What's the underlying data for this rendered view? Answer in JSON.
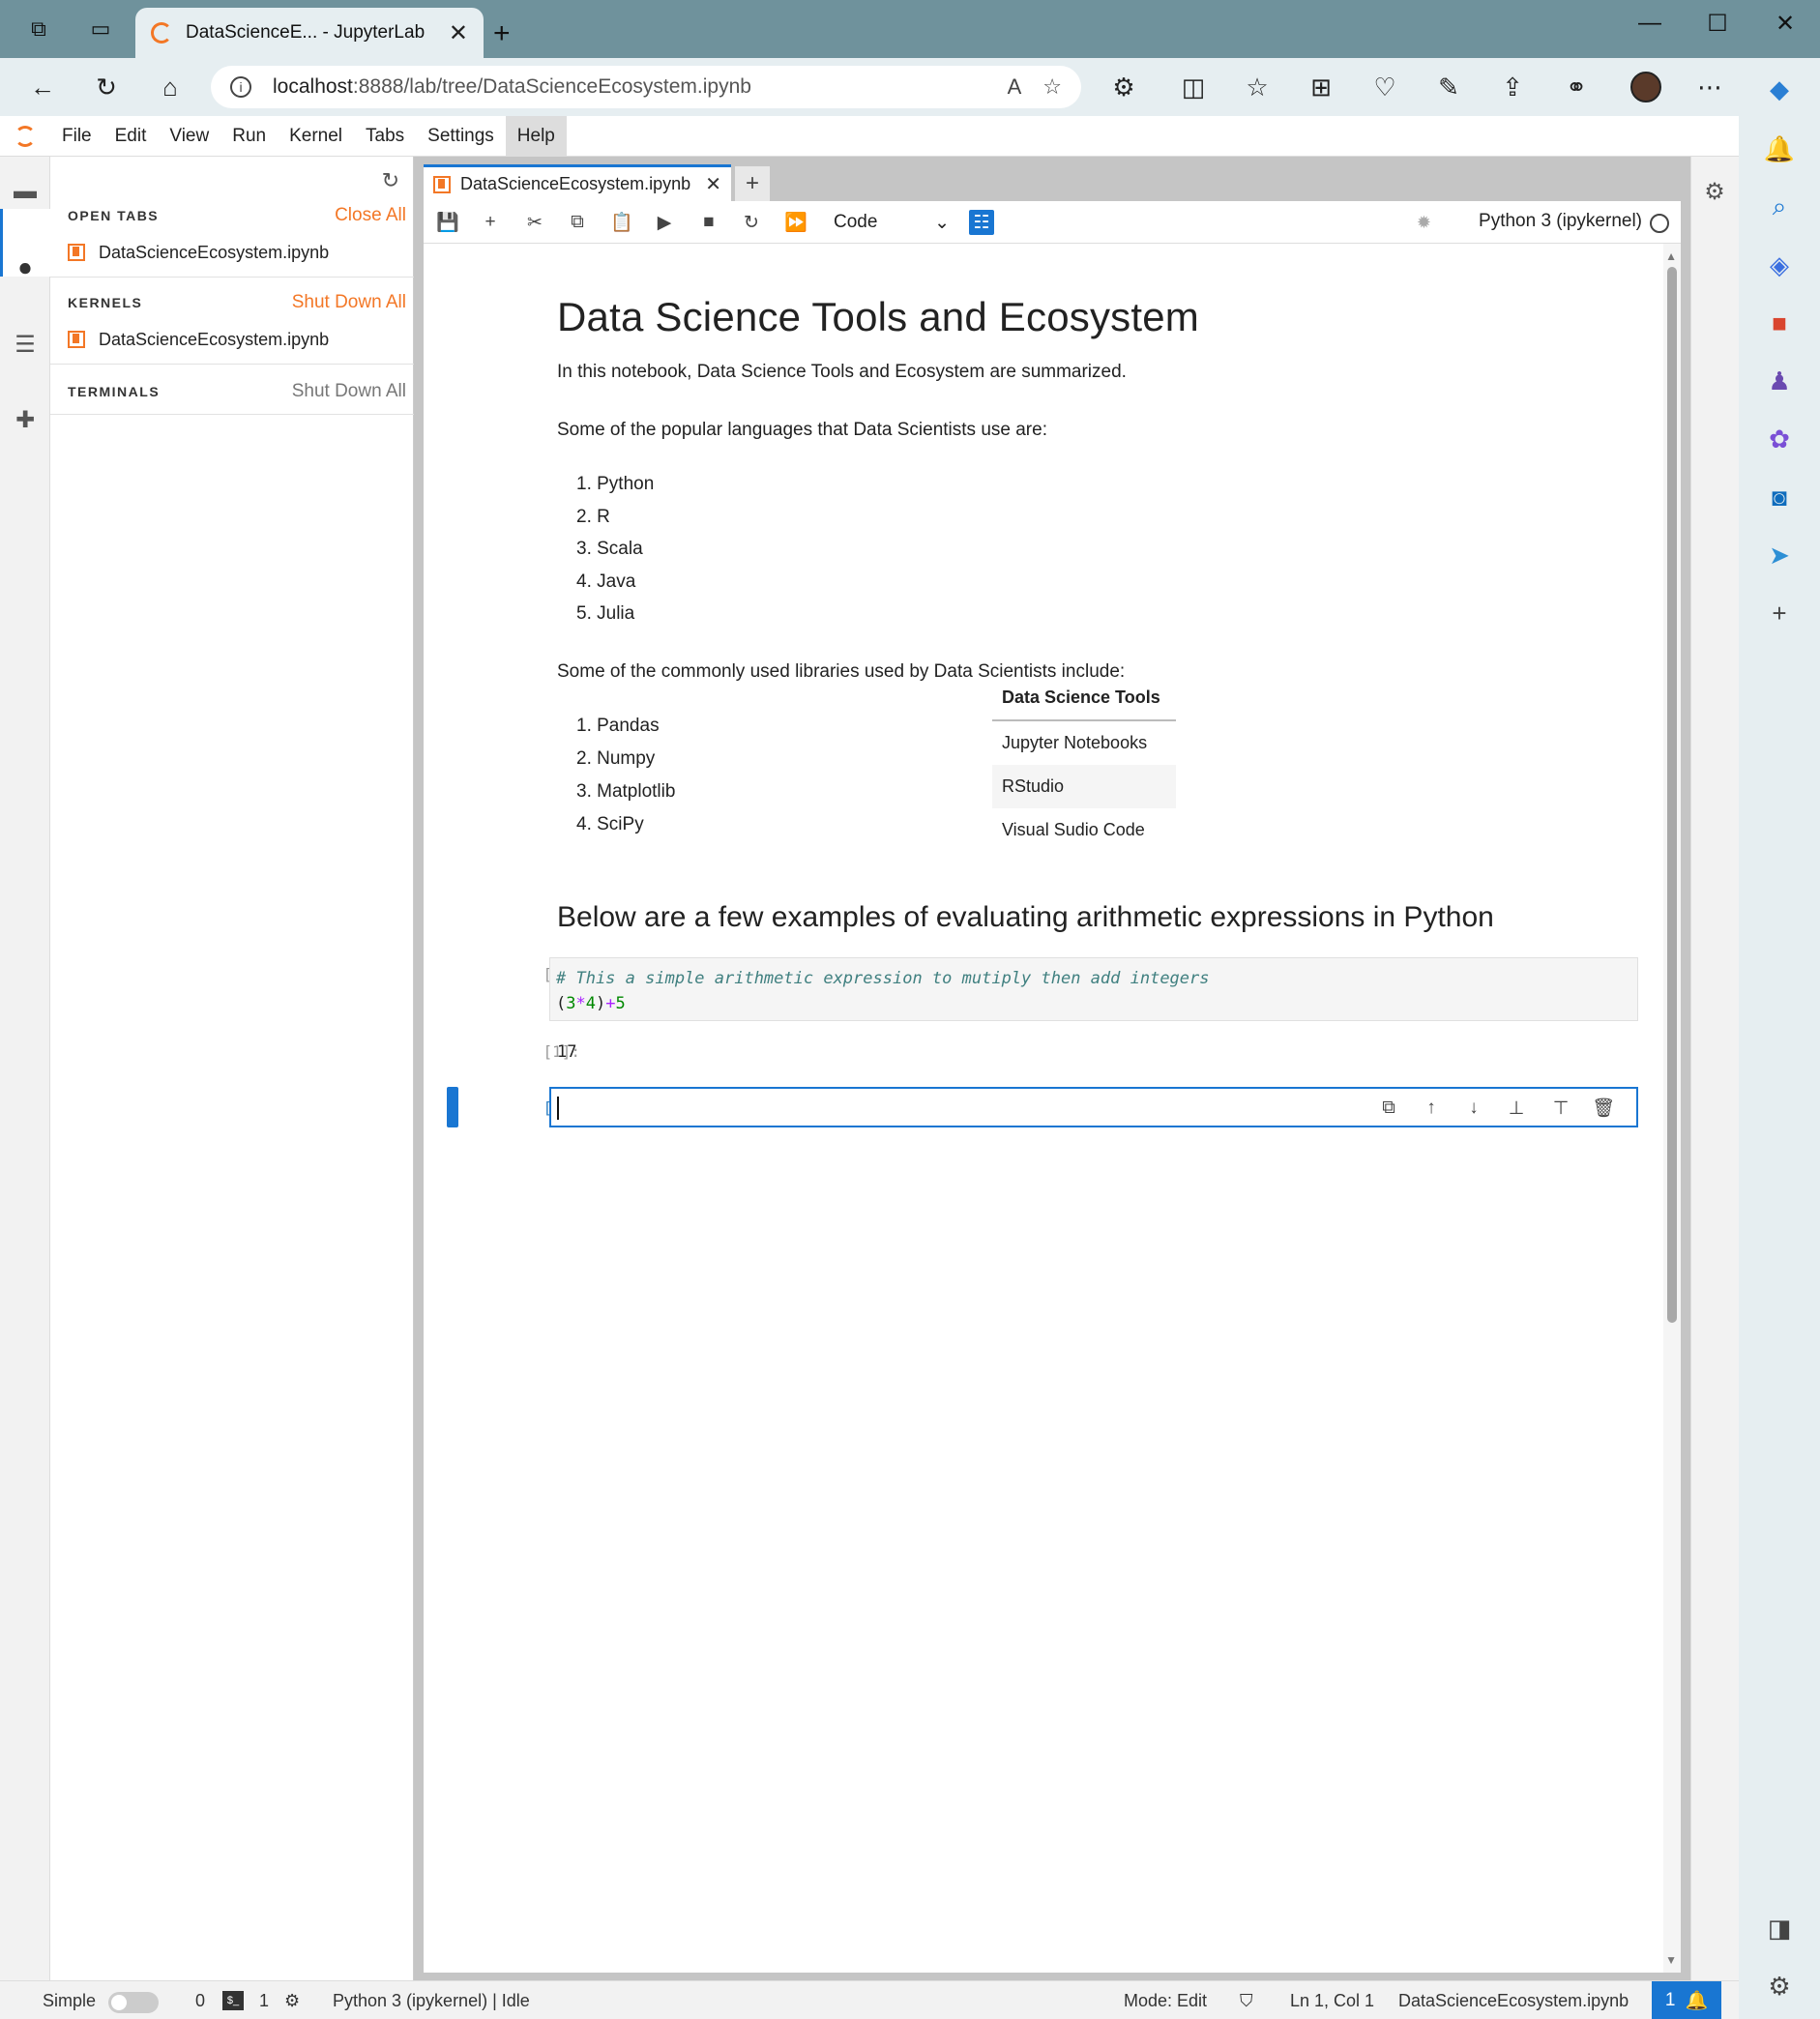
{
  "browser": {
    "tab_title": "DataScienceE... - JupyterLab",
    "url_host": "localhost",
    "url_rest": ":8888/lab/tree/DataScienceEcosystem.ipynb"
  },
  "menu": [
    "File",
    "Edit",
    "View",
    "Run",
    "Kernel",
    "Tabs",
    "Settings",
    "Help"
  ],
  "running_panel": {
    "open_tabs_label": "OPEN TABS",
    "open_tabs_action": "Close All",
    "open_tab_item": "DataScienceEcosystem.ipynb",
    "kernels_label": "KERNELS",
    "kernels_action": "Shut Down All",
    "kernel_item": "DataScienceEcosystem.ipynb",
    "terminals_label": "TERMINALS",
    "terminals_action": "Shut Down All"
  },
  "notebook": {
    "tab_name": "DataScienceEcosystem.ipynb",
    "cell_type": "Code",
    "kernel": "Python 3 (ipykernel)",
    "title": "Data Science Tools and Ecosystem",
    "intro": "In this notebook, Data Science Tools and Ecosystem are summarized.",
    "languages_intro": "Some of the popular languages that Data Scientists use are:",
    "languages": [
      "1. Python",
      "2. R",
      "3. Scala",
      "4. Java",
      "5. Julia"
    ],
    "libraries_intro": "Some of the commonly used libraries used by Data Scientists include:",
    "libraries": [
      "1. Pandas",
      "2. Numpy",
      "3. Matplotlib",
      "4. SciPy"
    ],
    "tools_header": "Data Science Tools",
    "tools": [
      "Jupyter Notebooks",
      "RStudio",
      "Visual Sudio Code"
    ],
    "arith_heading": "Below are a few examples of evaluating arithmetic expressions in Python",
    "code_prompt": "[1]:",
    "code_comment": "# This a simple arithmetic expression to mutiply then add integers",
    "output_prompt": "[1]:",
    "output_value": "17",
    "empty_prompt": "[ ]:"
  },
  "status": {
    "mode_label": "Simple",
    "terminals_count": "0",
    "kernels_count": "1",
    "kernel_status": "Python 3 (ipykernel) | Idle",
    "mode": "Mode: Edit",
    "cursor": "Ln 1, Col 1",
    "file": "DataScienceEcosystem.ipynb",
    "notifications": "1"
  },
  "colors": {
    "accent": "#1976d2",
    "jupyter_orange": "#f37726",
    "browser_frame": "#6f929c"
  }
}
